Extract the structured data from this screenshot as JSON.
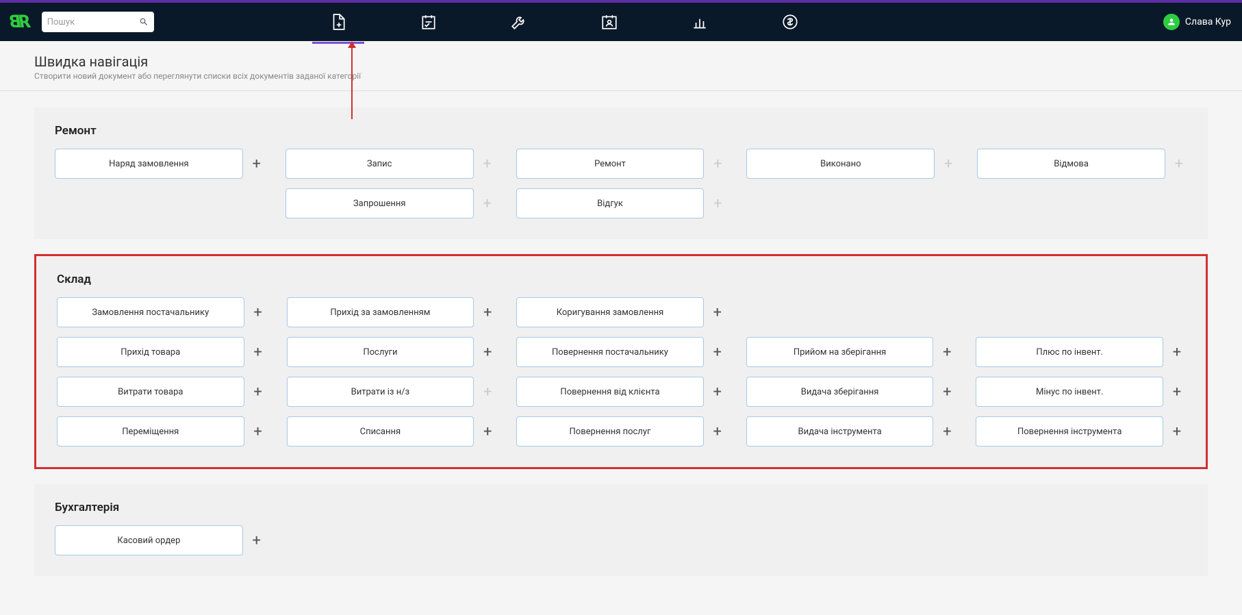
{
  "app": {
    "logo_text": "ЯВ"
  },
  "search": {
    "placeholder": "Пошук"
  },
  "user": {
    "name": "Слава Кур"
  },
  "page": {
    "title": "Швидка навігація",
    "subtitle": "Створити новий документ або переглянути списки всіх документів заданої категорії"
  },
  "sections": {
    "repair": {
      "title": "Ремонт",
      "items": [
        {
          "label": "Наряд замовлення",
          "plus": true
        },
        {
          "label": "Запис",
          "plus_disabled": true
        },
        {
          "label": "Ремонт",
          "plus_disabled": true
        },
        {
          "label": "Виконано",
          "plus_disabled": true
        },
        {
          "label": "Відмова",
          "plus_disabled": true
        },
        {
          "label": "Запрошення",
          "plus_disabled": true,
          "col_start": 2
        },
        {
          "label": "Відгук",
          "plus_disabled": true
        }
      ]
    },
    "warehouse": {
      "title": "Склад",
      "items": [
        {
          "label": "Замовлення постачальнику",
          "plus": true
        },
        {
          "label": "Прихід за замовленням",
          "plus": true
        },
        {
          "label": "Коригування замовлення",
          "plus": true
        },
        {
          "empty": true
        },
        {
          "empty": true
        },
        {
          "label": "Прихід товара",
          "plus": true
        },
        {
          "label": "Послуги",
          "plus": true
        },
        {
          "label": "Повернення постачальнику",
          "plus": true
        },
        {
          "label": "Прийом на зберігання",
          "plus": true
        },
        {
          "label": "Плюс по інвент.",
          "plus": true
        },
        {
          "label": "Витрати товара",
          "plus": true
        },
        {
          "label": "Витрати із н/з",
          "plus_disabled": true
        },
        {
          "label": "Повернення від клієнта",
          "plus": true
        },
        {
          "label": "Видача зберігання",
          "plus": true
        },
        {
          "label": "Мінус по інвент.",
          "plus": true
        },
        {
          "label": "Переміщення",
          "plus": true
        },
        {
          "label": "Списання",
          "plus": true
        },
        {
          "label": "Повернення послуг",
          "plus": true
        },
        {
          "label": "Видача інструмента",
          "plus": true
        },
        {
          "label": "Повернення інструмента",
          "plus": true
        }
      ]
    },
    "accounting": {
      "title": "Бухгалтерія",
      "items": [
        {
          "label": "Касовий ордер",
          "plus": true
        }
      ]
    }
  }
}
